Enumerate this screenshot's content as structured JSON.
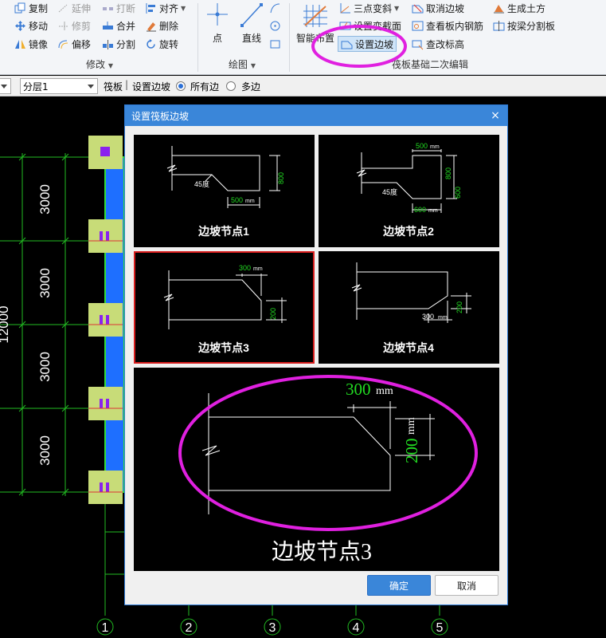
{
  "ribbon": {
    "modify": {
      "copy": "复制",
      "extend": "延伸",
      "break": "打断",
      "align": "对齐",
      "move": "移动",
      "trim": "修剪",
      "merge": "合并",
      "delete": "删除",
      "mirror": "镜像",
      "offset": "偏移",
      "split": "分割",
      "rotate": "旋转",
      "group_label": "修改"
    },
    "draw": {
      "point": "点",
      "line": "直线",
      "group_label": "绘图"
    },
    "raft": {
      "smart_place": "智能布置",
      "three_point_slope": "三点变斜",
      "set_section": "设置变截面",
      "set_edge_slope": "设置边坡",
      "cancel_edge_slope": "取消边坡",
      "view_rebar": "查看板内钢筋",
      "edit_elevation": "查改标高",
      "gen_earthwork": "生成土方",
      "split_by_beam": "按梁分割板",
      "group_label": "筏板基础二次编辑"
    }
  },
  "optbar": {
    "layer": "分层1",
    "element": "筏板",
    "command": "设置边坡",
    "opt_all_edges": "所有边",
    "opt_multi_edges": "多边"
  },
  "canvas": {
    "dims": [
      "3000",
      "3000",
      "3000",
      "3000"
    ],
    "total": "12000",
    "axes": [
      "1",
      "2",
      "3",
      "4",
      "5"
    ]
  },
  "dialog": {
    "title": "设置筏板边坡",
    "close": "×",
    "nodes": [
      {
        "label": "边坡节点1",
        "angle": "45度",
        "dim_a": "500",
        "dim_b": "800",
        "unit": "mm"
      },
      {
        "label": "边坡节点2",
        "angle": "45度",
        "dim_a": "500",
        "dim_b": "600",
        "dim_c": "800",
        "dim_d": "600",
        "unit": "mm"
      },
      {
        "label": "边坡节点3",
        "dim_a": "300",
        "dim_b": "200",
        "unit": "mm"
      },
      {
        "label": "边坡节点4",
        "dim_a": "300",
        "dim_b": "200",
        "unit": "mm"
      }
    ],
    "preview": {
      "label": "边坡节点3",
      "dim_a": "300",
      "dim_b": "200",
      "unit": "mm"
    },
    "ok": "确定",
    "cancel": "取消"
  },
  "colors": {
    "accent": "#3a86d9",
    "annotation": "#e020e0",
    "dim_green": "#22dd22",
    "slab_blue": "#1e6fff",
    "selected": "#d81e1e"
  }
}
